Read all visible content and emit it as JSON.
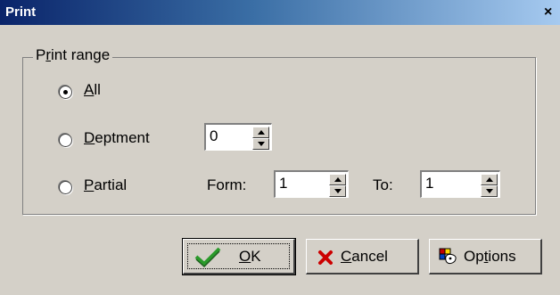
{
  "window": {
    "title": "Print",
    "close_glyph": "×"
  },
  "group": {
    "legend_prefix": "P",
    "legend_accel": "r",
    "legend_suffix": "int range"
  },
  "options": {
    "all": {
      "accel": "A",
      "rest": "ll",
      "selected": true
    },
    "department": {
      "accel": "D",
      "rest": "eptment",
      "value": "0"
    },
    "partial": {
      "accel": "P",
      "rest": "artial",
      "form_label": "Form:",
      "form_value": "1",
      "to_label": "To:",
      "to_value": "1"
    }
  },
  "buttons": {
    "ok": {
      "accel": "O",
      "rest": "K",
      "icon": "checkmark-icon"
    },
    "cancel": {
      "accel": "C",
      "rest": "ancel",
      "icon": "x-icon"
    },
    "options": {
      "prefix": "Op",
      "accel": "t",
      "rest": "ions",
      "icon": "options-icon"
    }
  },
  "colors": {
    "title_bar_start": "#0a246a",
    "dialog_bg": "#d4d0c8",
    "ok_check": "#2a9a2a",
    "cancel_x": "#cc0000"
  }
}
